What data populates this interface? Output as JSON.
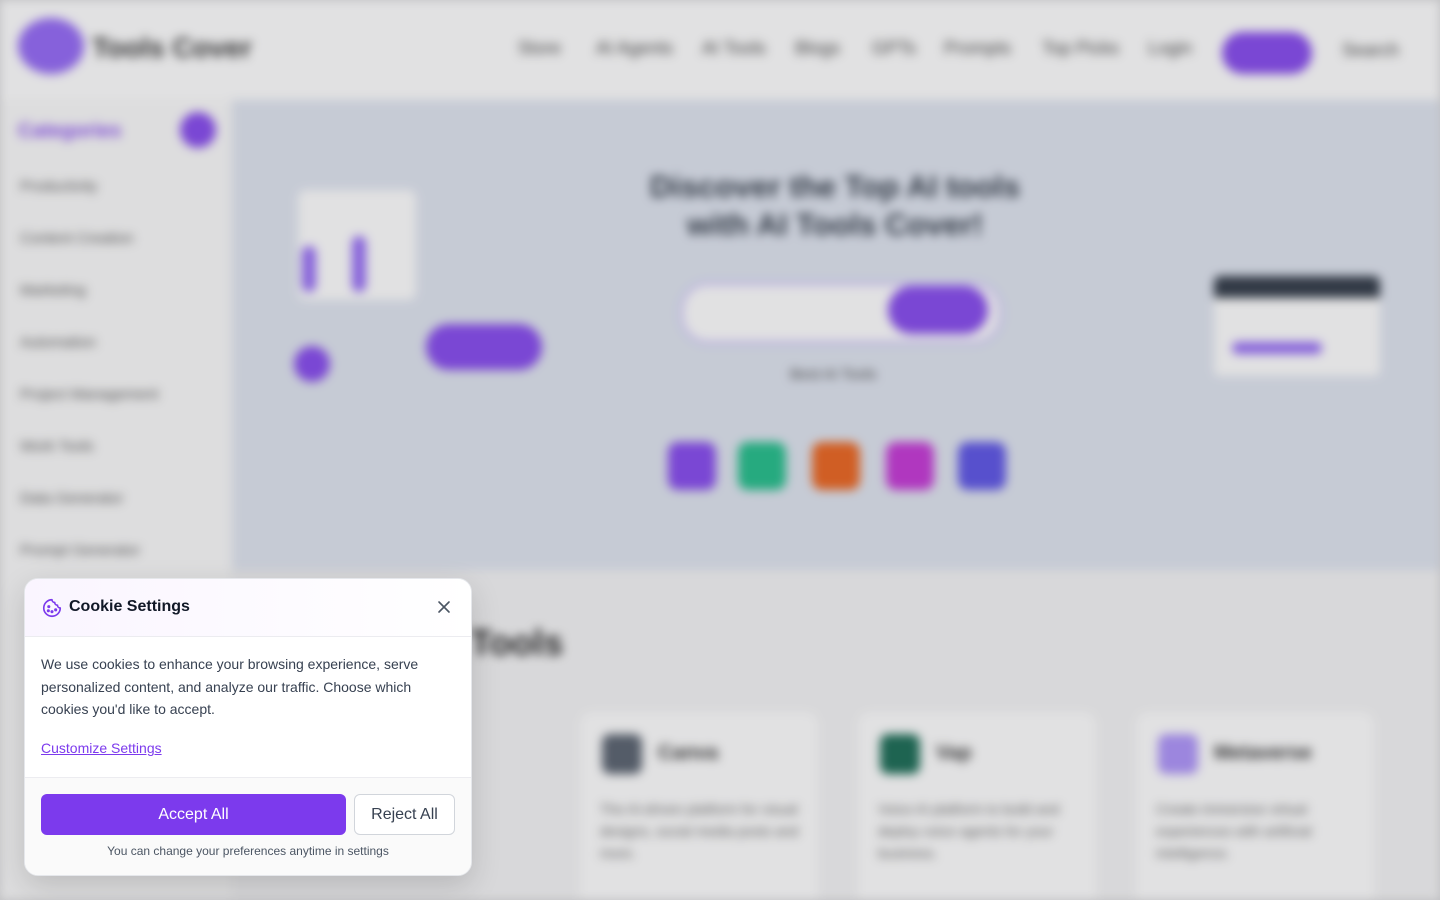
{
  "background": {
    "logo_text": "Tools Cover",
    "nav": [
      "Store",
      "AI Agents",
      "AI Tools",
      "Blogs",
      "GPTs",
      "Prompts",
      "Top Picks",
      "Login"
    ],
    "search_label": "Search",
    "sidebar_title": "Categories",
    "sidebar_items": [
      "Productivity",
      "Content Creation",
      "Marketing",
      "Automation",
      "Project Management",
      "Work Tools",
      "Data Generator",
      "Prompt Generator"
    ],
    "hero_title": "Discover the Top AI tools with AI Tools Cover!",
    "hero_sub": "Best AI Tools",
    "section_title": "Tools",
    "cards": [
      {
        "name": "Canva",
        "desc": "The AI-driven platform for visual designs, social media posts and more."
      },
      {
        "name": "Vap",
        "desc": "Voice AI platform to build and deploy voice agents for your business."
      },
      {
        "name": "Metaverse",
        "desc": "Create immersive virtual experiences with artificial intelligence."
      }
    ],
    "colors": {
      "accent": "#7c3aed",
      "tiles": [
        "#7c3aed",
        "#10b981",
        "#ea580c",
        "#c026d3",
        "#4f46e5"
      ]
    }
  },
  "cookie": {
    "title": "Cookie Settings",
    "icon": "cookie-icon",
    "body": "We use cookies to enhance your browsing experience, serve personalized content, and analyze our traffic. Choose which cookies you'd like to accept.",
    "customize_label": "Customize Settings",
    "accept_label": "Accept All",
    "reject_label": "Reject All",
    "footer_note": "You can change your preferences anytime in settings",
    "close_icon": "close-icon"
  }
}
